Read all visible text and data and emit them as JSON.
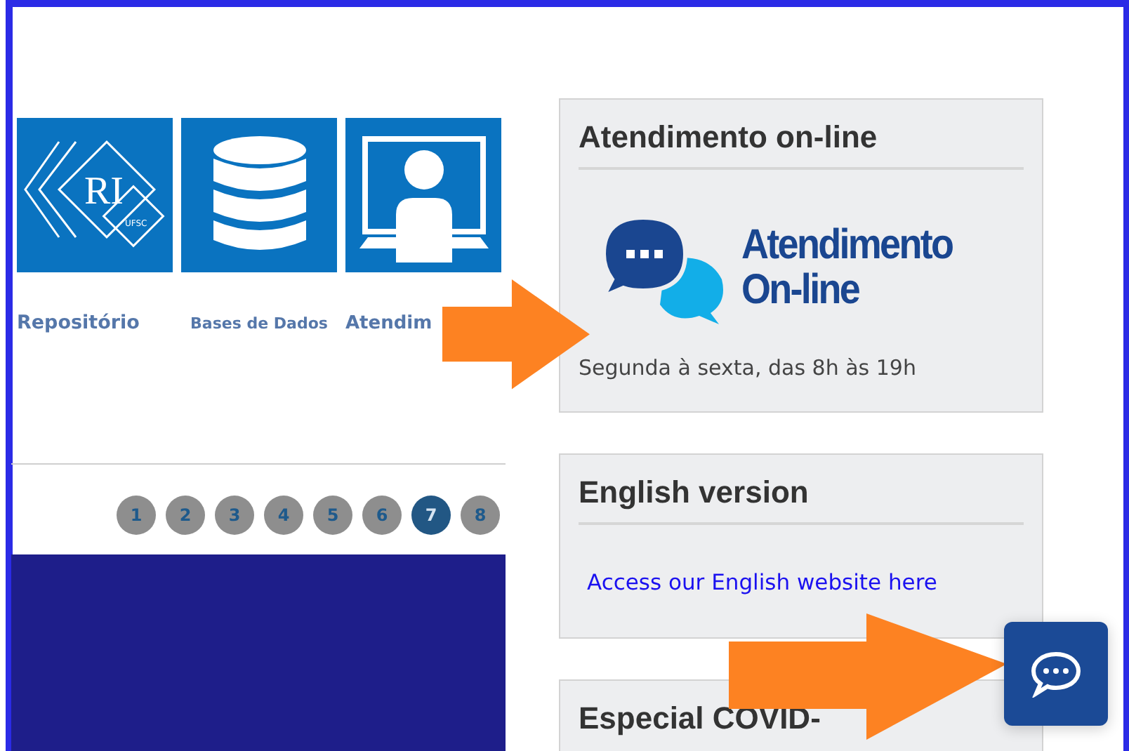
{
  "shortcuts": [
    {
      "label": "Repositório",
      "kind": "repository"
    },
    {
      "label": "Bases de Dados",
      "kind": "database"
    },
    {
      "label": "Atendim",
      "kind": "service"
    }
  ],
  "pagination": [
    {
      "label": "1",
      "selected": false
    },
    {
      "label": "2",
      "selected": false
    },
    {
      "label": "3",
      "selected": false
    },
    {
      "label": "4",
      "selected": false
    },
    {
      "label": "5",
      "selected": false
    },
    {
      "label": "6",
      "selected": false
    },
    {
      "label": "7",
      "selected": true
    },
    {
      "label": "8",
      "selected": false
    }
  ],
  "online_card": {
    "title": "Atendimento on-line",
    "logo_text": [
      "Atendimento",
      "On-line"
    ],
    "hours": "Segunda à sexta, das 8h às 19h"
  },
  "english_card": {
    "title": "English version",
    "link": "Access our English website here"
  },
  "covid_card": {
    "title": "Especial COVID-"
  },
  "logo_tile": {
    "text": "RI",
    "subtext": "UFSC"
  }
}
